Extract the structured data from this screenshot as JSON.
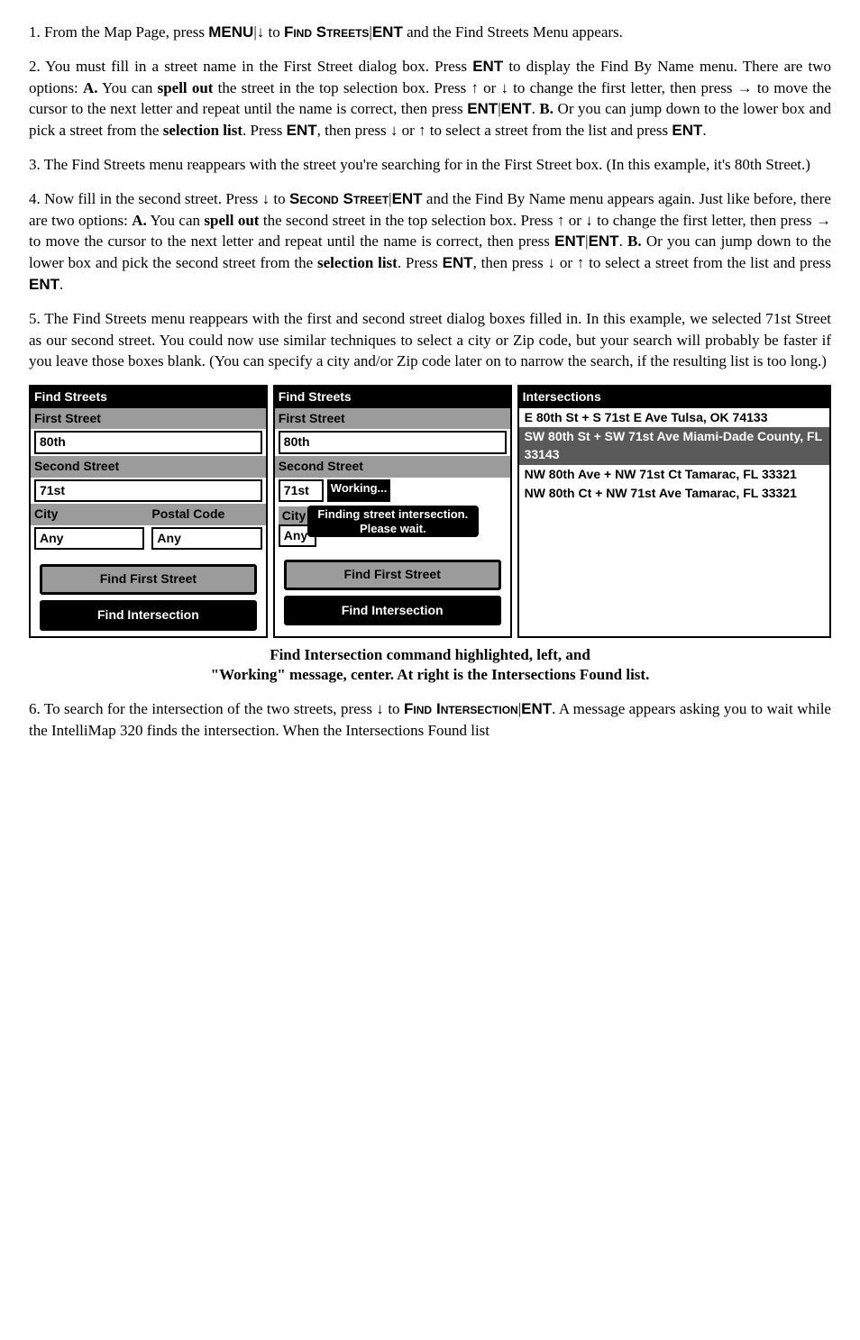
{
  "p1_a": "1. From the Map Page, press ",
  "p1_menu": "MENU",
  "p1_b": "|↓ to ",
  "p1_find": "Find Streets",
  "p1_c": "|",
  "p1_ent": "ENT",
  "p1_d": " and the Find Streets Menu appears.",
  "p2_a": "2. You must fill in a street name in the First Street dialog box. Press ",
  "p2_ent1": "ENT",
  "p2_b": " to display the Find By Name menu. There are two options: ",
  "p2_Atag": "A.",
  "p2_c": " You can ",
  "p2_spell": "spell out",
  "p2_d": " the street in the top selection box. Press ↑ or ↓ to change the first letter, then press → to move the cursor to the next letter and repeat until the name is correct, then press ",
  "p2_ent2": "ENT",
  "p2_e": "|",
  "p2_ent3": "ENT",
  "p2_f": ". ",
  "p2_Btag": "B.",
  "p2_g": " Or you can jump down to the lower box and pick a street from the ",
  "p2_sel": "selection list",
  "p2_h": ". Press ",
  "p2_ent4": "ENT",
  "p2_i": ", then press ↓ or ↑ to select a street from the list and press ",
  "p2_ent5": "ENT",
  "p2_j": ".",
  "p3": "3. The Find Streets menu reappears with the street you're searching for in the First Street box. (In this example, it's 80th Street.)",
  "p4_a": "4. Now fill in the second street. Press ↓ to ",
  "p4_sec": "Second Street",
  "p4_b": "|",
  "p4_ent1": "ENT",
  "p4_c": " and the Find By Name menu appears again. Just like before, there are two options: ",
  "p4_Atag": "A.",
  "p4_d": " You can ",
  "p4_spell": "spell out",
  "p4_e": " the second street in the top selection box. Press ↑ or ↓ to change the first letter, then press → to move the cursor to the next letter and repeat until the name is correct, then press ",
  "p4_ent2": "ENT",
  "p4_f": "|",
  "p4_ent3": "ENT",
  "p4_g": ". ",
  "p4_Btag": "B.",
  "p4_h": " Or you can jump down to the lower box and pick the second street from the ",
  "p4_sel": "selection list",
  "p4_i": ". Press ",
  "p4_ent4": "ENT",
  "p4_j": ", then press ↓ or ↑ to select a street from the list and press ",
  "p4_ent5": "ENT",
  "p4_k": ".",
  "p5": "5. The Find Streets menu reappears with the first and second street dialog boxes filled in. In this example, we selected 71st Street as our second street. You could now use similar techniques to select a city or Zip code, but your search will probably be faster if you leave those boxes blank. (You can specify a city and/or Zip code later on to narrow the search, if the resulting list is too long.)",
  "panelA": {
    "title": "Find Streets",
    "first_label": "First Street",
    "first_value": "80th",
    "second_label": "Second Street",
    "second_value": "71st",
    "city_label": "City",
    "postal_label": "Postal Code",
    "city_value": "Any",
    "postal_value": "Any",
    "btn_first": "Find First Street",
    "btn_inter": "Find Intersection"
  },
  "panelB": {
    "title": "Find Streets",
    "first_label": "First Street",
    "first_value": "80th",
    "second_label": "Second Street",
    "second_value": "71st",
    "working": "Working...",
    "city_label": "City",
    "any": "Any",
    "tooltip": "Finding street intersection. Please wait.",
    "btn_first": "Find First Street",
    "btn_inter": "Find Intersection"
  },
  "panelC": {
    "title": "Intersections",
    "items": [
      "E 80th St + S 71st E Ave Tulsa, OK  74133",
      "SW 80th St + SW 71st Ave Miami-Dade County, FL  33143",
      "NW 80th Ave + NW 71st Ct Tamarac, FL  33321",
      "NW 80th Ct + NW 71st Ave Tamarac, FL  33321"
    ]
  },
  "caption_a": "Find Intersection command highlighted, left, and",
  "caption_b": "\"Working\" message, center. At right is the Intersections Found list.",
  "p6_a": "6. To search for the intersection of the two streets, press ↓ to ",
  "p6_fi": "Find Intersection",
  "p6_b": "|",
  "p6_ent": "ENT",
  "p6_c": ". A message appears asking you to wait while the IntelliMap 320 finds the intersection. When the Intersections Found list"
}
